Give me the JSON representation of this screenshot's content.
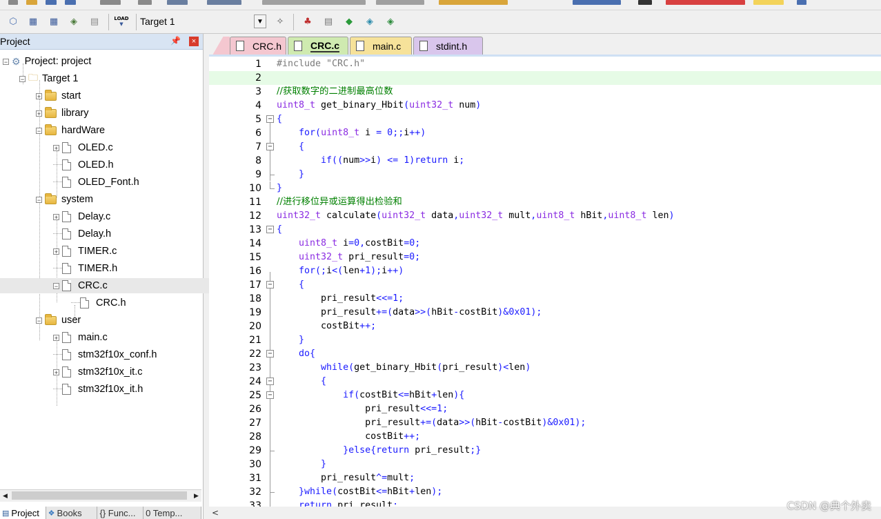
{
  "toolbar": {
    "target_name": "Target 1",
    "load_label": "LOAD"
  },
  "project_panel": {
    "title": "Project",
    "tree": [
      {
        "label": "Project: project",
        "type": "project"
      },
      {
        "label": "Target 1",
        "type": "target"
      },
      {
        "label": "start",
        "type": "folder"
      },
      {
        "label": "library",
        "type": "folder"
      },
      {
        "label": "hardWare",
        "type": "folder"
      },
      {
        "label": "OLED.c",
        "type": "file"
      },
      {
        "label": "OLED.h",
        "type": "file"
      },
      {
        "label": "OLED_Font.h",
        "type": "file"
      },
      {
        "label": "system",
        "type": "folder"
      },
      {
        "label": "Delay.c",
        "type": "file"
      },
      {
        "label": "Delay.h",
        "type": "file"
      },
      {
        "label": "TIMER.c",
        "type": "file"
      },
      {
        "label": "TIMER.h",
        "type": "file"
      },
      {
        "label": "CRC.c",
        "type": "file"
      },
      {
        "label": "CRC.h",
        "type": "file"
      },
      {
        "label": "user",
        "type": "folder"
      },
      {
        "label": "main.c",
        "type": "file"
      },
      {
        "label": "stm32f10x_conf.h",
        "type": "file"
      },
      {
        "label": "stm32f10x_it.c",
        "type": "file"
      },
      {
        "label": "stm32f10x_it.h",
        "type": "file"
      }
    ],
    "bottom_tabs": [
      {
        "label": "Project",
        "icon": "project-icon"
      },
      {
        "label": "Books",
        "icon": "books-icon"
      },
      {
        "label": "{} Func...",
        "icon": "functions-icon"
      },
      {
        "label": "0 Temp...",
        "icon": "templates-icon"
      }
    ]
  },
  "editor": {
    "tabs": [
      {
        "label": "CRC.h",
        "color": "#f4c7d0"
      },
      {
        "label": "CRC.c",
        "color": "#cfeab0",
        "active": true
      },
      {
        "label": "main.c",
        "color": "#f6e29a"
      },
      {
        "label": "stdint.h",
        "color": "#d9c6ec"
      }
    ],
    "lines": [
      {
        "n": "1",
        "html": "<span class='pp'>#include \"CRC.h\"</span>"
      },
      {
        "n": "2",
        "html": ""
      },
      {
        "n": "3",
        "html": "<span class='cm'>//获取数字的二进制最高位数</span>"
      },
      {
        "n": "4",
        "html": "<span class='ty'>uint8_t</span> get_binary_Hbit<span class='kw'>(</span><span class='ty'>uint32_t</span> num<span class='kw'>)</span>"
      },
      {
        "n": "5",
        "html": "<span class='kw'>{</span>"
      },
      {
        "n": "6",
        "html": "    <span class='kw'>for(</span><span class='ty'>uint8_t</span> i <span class='kw'>=</span> <span class='num'>0</span><span class='kw'>;;</span>i<span class='kw'>++)</span>"
      },
      {
        "n": "7",
        "html": "    <span class='kw'>{</span>"
      },
      {
        "n": "8",
        "html": "        <span class='kw'>if((</span>num<span class='kw'>&gt;&gt;</span>i<span class='kw'>)</span> <span class='kw'>&lt;=</span> <span class='num'>1</span><span class='kw'>)return</span> i<span class='kw'>;</span>"
      },
      {
        "n": "9",
        "html": "    <span class='kw'>}</span>"
      },
      {
        "n": "10",
        "html": "<span class='kw'>}</span>"
      },
      {
        "n": "11",
        "html": "<span class='cm'>//进行移位异或运算得出检验和</span>"
      },
      {
        "n": "12",
        "html": "<span class='ty'>uint32_t</span> calculate<span class='kw'>(</span><span class='ty'>uint32_t</span> data<span class='kw'>,</span><span class='ty'>uint32_t</span> mult<span class='kw'>,</span><span class='ty'>uint8_t</span> hBit<span class='kw'>,</span><span class='ty'>uint8_t</span> len<span class='kw'>)</span>"
      },
      {
        "n": "13",
        "html": "<span class='kw'>{</span>"
      },
      {
        "n": "14",
        "html": "    <span class='ty'>uint8_t</span> i<span class='kw'>=</span><span class='num'>0</span><span class='kw'>,</span>costBit<span class='kw'>=</span><span class='num'>0</span><span class='kw'>;</span>"
      },
      {
        "n": "15",
        "html": "    <span class='ty'>uint32_t</span> pri_result<span class='kw'>=</span><span class='num'>0</span><span class='kw'>;</span>"
      },
      {
        "n": "16",
        "html": "    <span class='kw'>for(;</span>i<span class='kw'>&lt;(</span>len<span class='kw'>+</span><span class='num'>1</span><span class='kw'>);</span>i<span class='kw'>++)</span>"
      },
      {
        "n": "17",
        "html": "    <span class='kw'>{</span>"
      },
      {
        "n": "18",
        "html": "        pri_result<span class='kw'>&lt;&lt;=</span><span class='num'>1</span><span class='kw'>;</span>"
      },
      {
        "n": "19",
        "html": "        pri_result<span class='kw'>+=(</span>data<span class='kw'>&gt;&gt;(</span>hBit<span class='kw'>-</span>costBit<span class='kw'>)&amp;</span><span class='num'>0x01</span><span class='kw'>);</span>"
      },
      {
        "n": "20",
        "html": "        costBit<span class='kw'>++;</span>"
      },
      {
        "n": "21",
        "html": "    <span class='kw'>}</span>"
      },
      {
        "n": "22",
        "html": "    <span class='kw'>do{</span>"
      },
      {
        "n": "23",
        "html": "        <span class='kw'>while(</span>get_binary_Hbit<span class='kw'>(</span>pri_result<span class='kw'>)&lt;</span>len<span class='kw'>)</span>"
      },
      {
        "n": "24",
        "html": "        <span class='kw'>{</span>"
      },
      {
        "n": "25",
        "html": "            <span class='kw'>if(</span>costBit<span class='kw'>&lt;=</span>hBit<span class='kw'>+</span>len<span class='kw'>){</span>"
      },
      {
        "n": "26",
        "html": "                pri_result<span class='kw'>&lt;&lt;=</span><span class='num'>1</span><span class='kw'>;</span>"
      },
      {
        "n": "27",
        "html": "                pri_result<span class='kw'>+=(</span>data<span class='kw'>&gt;&gt;(</span>hBit<span class='kw'>-</span>costBit<span class='kw'>)&amp;</span><span class='num'>0x01</span><span class='kw'>);</span>"
      },
      {
        "n": "28",
        "html": "                costBit<span class='kw'>++;</span>"
      },
      {
        "n": "29",
        "html": "            <span class='kw'>}else{return</span> pri_result<span class='kw'>;}</span>"
      },
      {
        "n": "30",
        "html": "        <span class='kw'>}</span>"
      },
      {
        "n": "31",
        "html": "        pri_result<span class='kw'>^=</span>mult<span class='kw'>;</span>"
      },
      {
        "n": "32",
        "html": "    <span class='kw'>}while(</span>costBit<span class='kw'>&lt;=</span>hBit<span class='kw'>+</span>len<span class='kw'>);</span>"
      },
      {
        "n": "33",
        "html": "    <span class='kw'>return</span> pri_result<span class='kw'>;</span>"
      }
    ]
  },
  "watermark": "CSDN @典个外卖"
}
